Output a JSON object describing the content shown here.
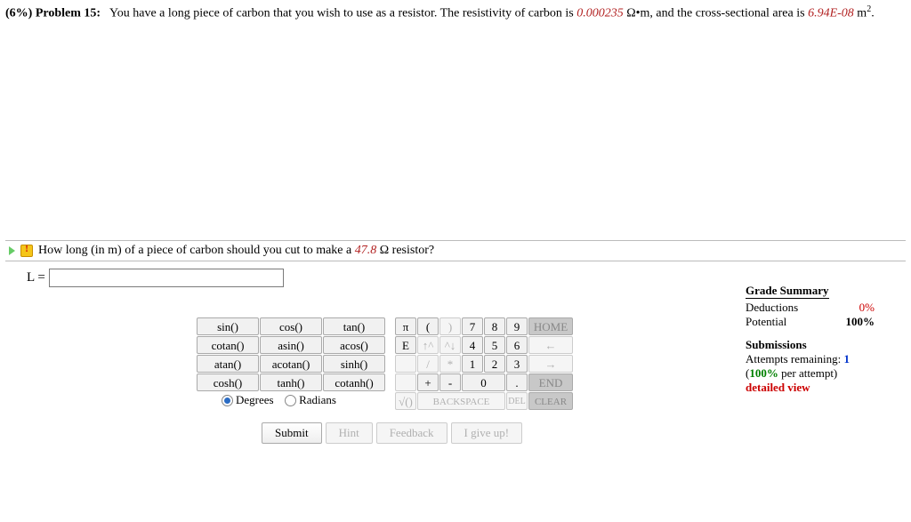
{
  "problem": {
    "weight_label": "(6%)",
    "title_label": "Problem 15:",
    "text_before_rho": "You have a long piece of carbon that you wish to use as a resistor. The resistivity of carbon is ",
    "rho": "0.000235",
    "rho_unit_prefix": "Ω•m",
    "text_mid": ", and the cross-sectional area is ",
    "area": "6.94E-08",
    "area_unit_base": "m",
    "area_unit_exp": "2",
    "period": "."
  },
  "question": {
    "text_before": "How long (in m) of a piece of carbon should you cut to make a ",
    "value": "47.8",
    "text_after": " Ω resistor?"
  },
  "answer": {
    "var_label": "L = ",
    "value": ""
  },
  "calc": {
    "funcs": [
      [
        "sin()",
        "cos()",
        "tan()"
      ],
      [
        "cotan()",
        "asin()",
        "acos()"
      ],
      [
        "atan()",
        "acotan()",
        "sinh()"
      ],
      [
        "cosh()",
        "tanh()",
        "cotanh()"
      ]
    ],
    "mode_degrees": "Degrees",
    "mode_radians": "Radians",
    "sym": {
      "pi": "π",
      "lp": "(",
      "rp": ")",
      "E": "E",
      "up": "↑^",
      "down": "^↓",
      "slash": "/",
      "star": "*",
      "plus": "+",
      "minus": "-",
      "sqrt": "√()",
      "back": "BACKSPACE",
      "del": "DEL",
      "clear": "CLEAR",
      "dot": "."
    },
    "num": {
      "7": "7",
      "8": "8",
      "9": "9",
      "4": "4",
      "5": "5",
      "6": "6",
      "1": "1",
      "2": "2",
      "3": "3",
      "0": "0"
    },
    "nav": {
      "home": "HOME",
      "left": "←",
      "right": "→",
      "end": "END"
    }
  },
  "actions": {
    "submit": "Submit",
    "hint": "Hint",
    "feedback": "Feedback",
    "giveup": "I give up!"
  },
  "summary": {
    "grade_hdr": "Grade Summary",
    "deductions_label": "Deductions",
    "deductions_value": "0%",
    "potential_label": "Potential",
    "potential_value": "100%",
    "submissions_hdr": "Submissions",
    "attempts_label_a": "Attempts remaining: ",
    "attempts_value": "1",
    "per_attempt_a": "(",
    "per_attempt_val": "100%",
    "per_attempt_b": " per attempt)",
    "detailed": "detailed view"
  }
}
